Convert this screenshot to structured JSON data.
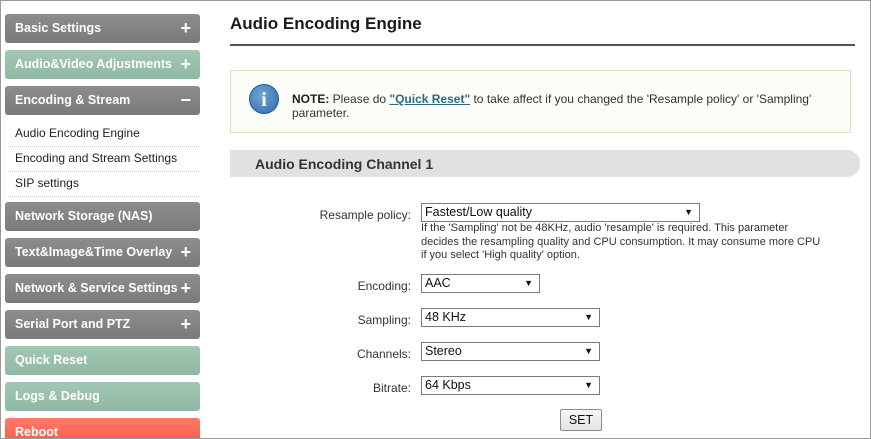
{
  "sidebar": {
    "items": [
      {
        "label": "Basic Settings",
        "sign": "+"
      },
      {
        "label": "Audio&Video Adjustments",
        "sign": "+"
      },
      {
        "label": "Encoding & Stream",
        "sign": "−"
      },
      {
        "label": "Network Storage (NAS)",
        "sign": ""
      },
      {
        "label": "Text&Image&Time Overlay",
        "sign": "+"
      },
      {
        "label": "Network & Service Settings",
        "sign": "+"
      },
      {
        "label": "Serial Port and PTZ",
        "sign": "+"
      },
      {
        "label": "Quick Reset",
        "sign": ""
      },
      {
        "label": "Logs & Debug",
        "sign": ""
      },
      {
        "label": "Reboot",
        "sign": ""
      }
    ],
    "sub_items": [
      {
        "label": "Audio Encoding Engine"
      },
      {
        "label": "Encoding and Stream Settings"
      },
      {
        "label": "SIP settings"
      }
    ]
  },
  "main": {
    "title": "Audio Encoding Engine",
    "note": {
      "prefix": "NOTE:",
      "text_before": " Please do ",
      "link": "\"Quick Reset\"",
      "text_after": " to take affect if you changed the 'Resample policy' or 'Sampling' parameter."
    },
    "channel_title": "Audio Encoding Channel 1",
    "form": {
      "resample": {
        "label": "Resample policy:",
        "value": "Fastest/Low quality"
      },
      "resample_hint": "If the 'Sampling' not be 48KHz, audio 'resample' is required. This parameter decides the resampling quality and CPU consumption. It may consume more CPU if you select 'High quality' option.",
      "encoding": {
        "label": "Encoding:",
        "value": "AAC"
      },
      "sampling": {
        "label": "Sampling:",
        "value": "48 KHz"
      },
      "channels": {
        "label": "Channels:",
        "value": "Stereo"
      },
      "bitrate": {
        "label": "Bitrate:",
        "value": "64 Kbps"
      },
      "set_label": "SET"
    }
  },
  "colors": {
    "nav_gray": "#858585",
    "nav_green": "#9bc2ad",
    "nav_red": "#f7604f",
    "note_border": "#d9e4bf",
    "link": "#2b6b7e"
  }
}
